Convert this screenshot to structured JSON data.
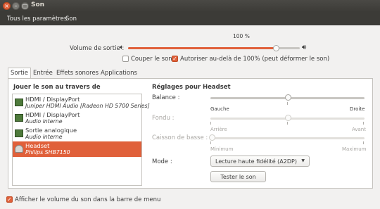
{
  "window": {
    "title": "Son"
  },
  "toolbar": {
    "all_settings": "Tous les paramètres",
    "current": "Son"
  },
  "output_volume": {
    "label": "Volume de sortie :",
    "percent_label": "100 %",
    "level": 0.86,
    "mute_label": "Couper le son",
    "mute_checked": false,
    "amplify_label": "Autoriser au-delà de 100% (peut déformer le son)",
    "amplify_checked": true
  },
  "tabs": [
    {
      "label": "Sortie",
      "active": true
    },
    {
      "label": "Entrée",
      "active": false
    },
    {
      "label": "Effets sonores",
      "active": false
    },
    {
      "label": "Applications",
      "active": false
    }
  ],
  "device_list": {
    "heading": "Jouer le son au travers de",
    "items": [
      {
        "name": "HDMI / DisplayPort",
        "sub": "Juniper HDMI Audio [Radeon HD 5700 Series]",
        "icon": "sound-card-icon",
        "selected": false
      },
      {
        "name": "HDMI / DisplayPort",
        "sub": "Audio interne",
        "icon": "sound-card-icon",
        "selected": false
      },
      {
        "name": "Sortie analogique",
        "sub": "Audio interne",
        "icon": "sound-card-icon",
        "selected": false
      },
      {
        "name": "Headset",
        "sub": "Philips SHB7150",
        "icon": "headset-icon",
        "selected": true
      }
    ]
  },
  "settings": {
    "heading": "Réglages pour Headset",
    "balance": {
      "label": "Balance :",
      "left": "Gauche",
      "right": "Droite",
      "value": 0.5
    },
    "fade": {
      "label": "Fondu :",
      "left": "Arrière",
      "right": "Avant",
      "value": 0.5
    },
    "subwoofer": {
      "label": "Caisson de basse :",
      "left": "Minimum",
      "right": "Maximum",
      "value": 0.0
    },
    "mode": {
      "label": "Mode :",
      "value": "Lecture haute fidélité (A2DP)"
    },
    "test_button": "Tester le son"
  },
  "footer": {
    "show_volume_label": "Afficher le volume du son dans la barre de menu",
    "show_volume_checked": true
  },
  "colors": {
    "accent": "#e0603a",
    "titlebar": "#3c3b37"
  }
}
